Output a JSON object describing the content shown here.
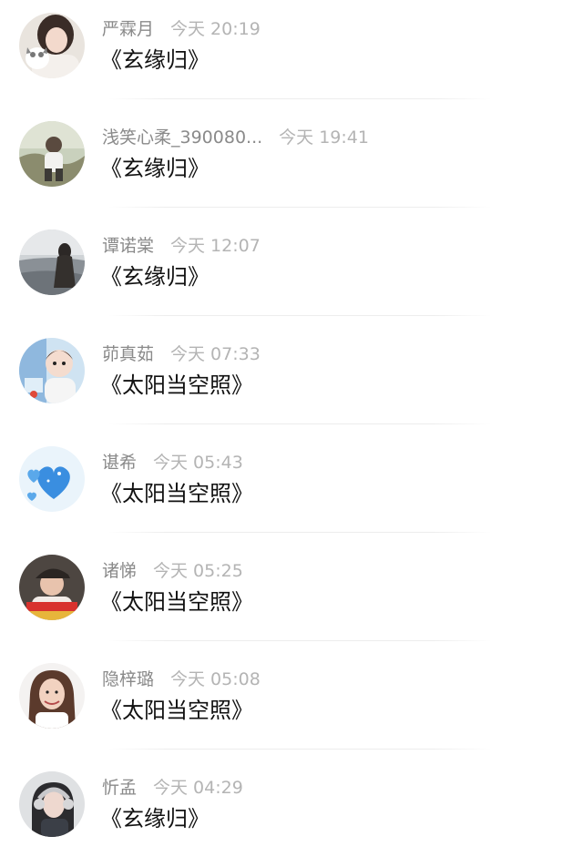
{
  "comments": [
    {
      "name": "严霖月",
      "time": "今天 20:19",
      "song": "《玄缘归》",
      "avatar": "girl-with-cat-avatar"
    },
    {
      "name": "浅笑心柔_390080...",
      "time": "今天 19:41",
      "song": "《玄缘归》",
      "avatar": "person-outdoors-avatar"
    },
    {
      "name": "谭诺棠",
      "time": "今天 12:07",
      "song": "《玄缘归》",
      "avatar": "seaside-silhouette-avatar"
    },
    {
      "name": "茆真茹",
      "time": "今天 07:33",
      "song": "《太阳当空照》",
      "avatar": "child-avatar"
    },
    {
      "name": "谌希",
      "time": "今天 05:43",
      "song": "《太阳当空照》",
      "avatar": "blue-hearts-avatar"
    },
    {
      "name": "诸悌",
      "time": "今天 05:25",
      "song": "《太阳当空照》",
      "avatar": "man-in-cap-avatar"
    },
    {
      "name": "隐梓璐",
      "time": "今天 05:08",
      "song": "《太阳当空照》",
      "avatar": "smiling-woman-avatar"
    },
    {
      "name": "忻孟",
      "time": "今天 04:29",
      "song": "《玄缘归》",
      "avatar": "girl-with-headphones-avatar"
    }
  ]
}
